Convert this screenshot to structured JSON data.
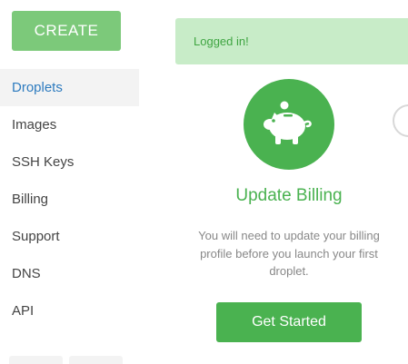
{
  "sidebar": {
    "create_label": "CREATE",
    "items": [
      {
        "label": "Droplets",
        "active": true
      },
      {
        "label": "Images"
      },
      {
        "label": "SSH Keys"
      },
      {
        "label": "Billing"
      },
      {
        "label": "Support"
      },
      {
        "label": "DNS"
      },
      {
        "label": "API"
      }
    ]
  },
  "flash": {
    "message": "Logged in!"
  },
  "main": {
    "icon": "piggy-bank-icon",
    "heading": "Update Billing",
    "description": "You will need to update your billing profile before you launch your first droplet.",
    "cta_label": "Get Started"
  },
  "colors": {
    "brand_green": "#4ab250",
    "create_green": "#7cc97a",
    "flash_bg": "#c8ecc8",
    "active_link": "#2d7bbf"
  }
}
